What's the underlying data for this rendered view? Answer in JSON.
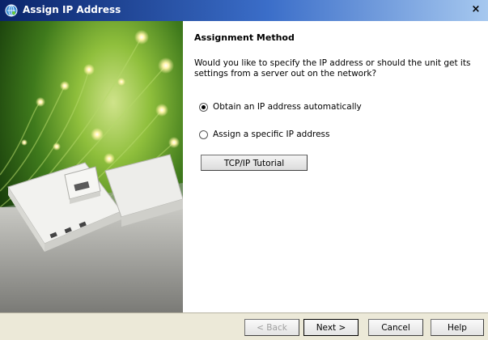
{
  "window": {
    "title": "Assign IP Address",
    "close_label": "×"
  },
  "colors": {
    "titlebar_start": "#0a246a",
    "titlebar_end": "#a6c8ef",
    "footer_bg": "#ece9d8"
  },
  "page": {
    "heading": "Assignment Method",
    "description": "Would you like to specify the IP address or should the unit get its settings from a server out on the network?"
  },
  "options": [
    {
      "label": "Obtain an IP address automatically",
      "selected": true
    },
    {
      "label": "Assign a specific IP address",
      "selected": false
    }
  ],
  "tutorial_button": "TCP/IP Tutorial",
  "footer": {
    "back": "< Back",
    "back_enabled": false,
    "next": "Next >",
    "cancel": "Cancel",
    "help": "Help"
  },
  "side_image": {
    "icon": "network-devices-fiber-optics-image"
  }
}
